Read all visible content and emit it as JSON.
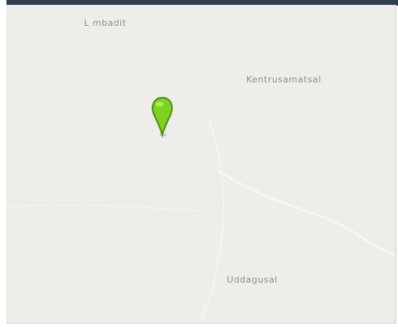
{
  "map": {
    "labels": {
      "top": "L mbadit",
      "right": "Kentrusamatsal",
      "bottom": "Uddagusal"
    },
    "marker": {
      "color": "#7ed321",
      "icon": "map-pin-icon"
    },
    "colors": {
      "land": "#efedea",
      "header": "#2f3d4c",
      "label_text": "#8e8e8e"
    }
  }
}
